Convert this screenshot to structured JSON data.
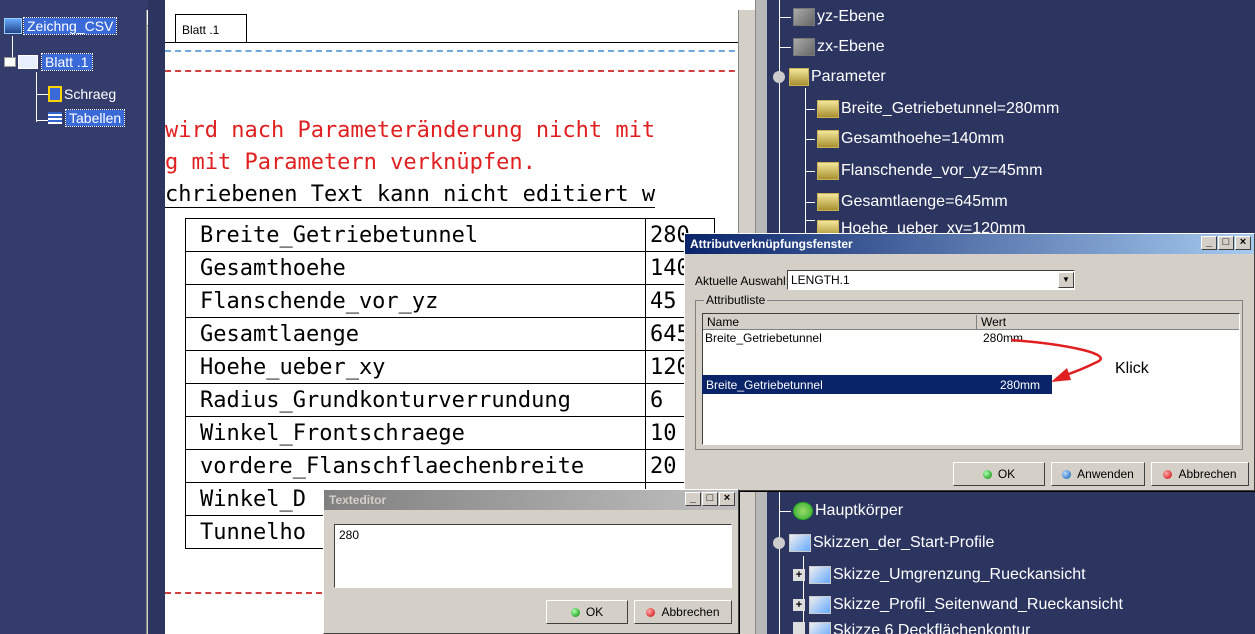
{
  "left_tree": {
    "root_label": "Zeichng_CSV",
    "sheet_label": "Blatt .1",
    "child1_label": "Schraeg",
    "child2_label": "Tabellen"
  },
  "drawing": {
    "tab_label": "Blatt .1",
    "red_line1": "wird nach Parameteränderung nicht mit",
    "red_line2": "g mit Parametern verknüpfen.",
    "black_line": "chriebenen Text kann nicht editiert w",
    "table": [
      {
        "name": "Breite_Getriebetunnel",
        "value": "280"
      },
      {
        "name": "Gesamthoehe",
        "value": "140"
      },
      {
        "name": "Flanschende_vor_yz",
        "value": "45"
      },
      {
        "name": "Gesamtlaenge",
        "value": "645"
      },
      {
        "name": "Hoehe_ueber_xy",
        "value": "120"
      },
      {
        "name": "Radius_Grundkonturverrundung",
        "value": "6"
      },
      {
        "name": "Winkel_Frontschraege",
        "value": "10"
      },
      {
        "name": "vordere_Flanschflaechenbreite",
        "value": "20"
      },
      {
        "name": "Winkel_D",
        "value": ""
      },
      {
        "name": "Tunnelho",
        "value": ""
      }
    ]
  },
  "right_tree": {
    "yz_plane": "yz-Ebene",
    "zx_plane": "zx-Ebene",
    "parameter": "Parameter",
    "p1": "Breite_Getriebetunnel=280mm",
    "p2": "Gesamthoehe=140mm",
    "p3": "Flanschende_vor_yz=45mm",
    "p4": "Gesamtlaenge=645mm",
    "p5_partial": "Hoehe_ueber_xy=120mm",
    "hauptkoerper": "Hauptkörper",
    "skizzen": "Skizzen_der_Start-Profile",
    "s1": "Skizze_Umgrenzung_Rueckansicht",
    "s2": "Skizze_Profil_Seitenwand_Rueckansicht",
    "s3_partial": "Skizze 6 Deckflächenkontur"
  },
  "attr_dialog": {
    "title": "Attributverknüpfungsfenster",
    "current_label": "Aktuelle Auswahl:",
    "current_value": "LENGTH.1",
    "list_group": "Attributliste",
    "col_name": "Name",
    "col_value": "Wert",
    "row_name": "Breite_Getriebetunnel",
    "row_value": "280mm",
    "selected_name": "Breite_Getriebetunnel",
    "selected_value": "280mm",
    "annotation": "Klick",
    "ok": "OK",
    "apply": "Anwenden",
    "cancel": "Abbrechen"
  },
  "text_editor": {
    "title": "Texteditor",
    "content": "280",
    "ok": "OK",
    "cancel": "Abbrechen"
  },
  "colors": {
    "annotation_arrow": "#e02020",
    "selection": "#0a246a"
  }
}
